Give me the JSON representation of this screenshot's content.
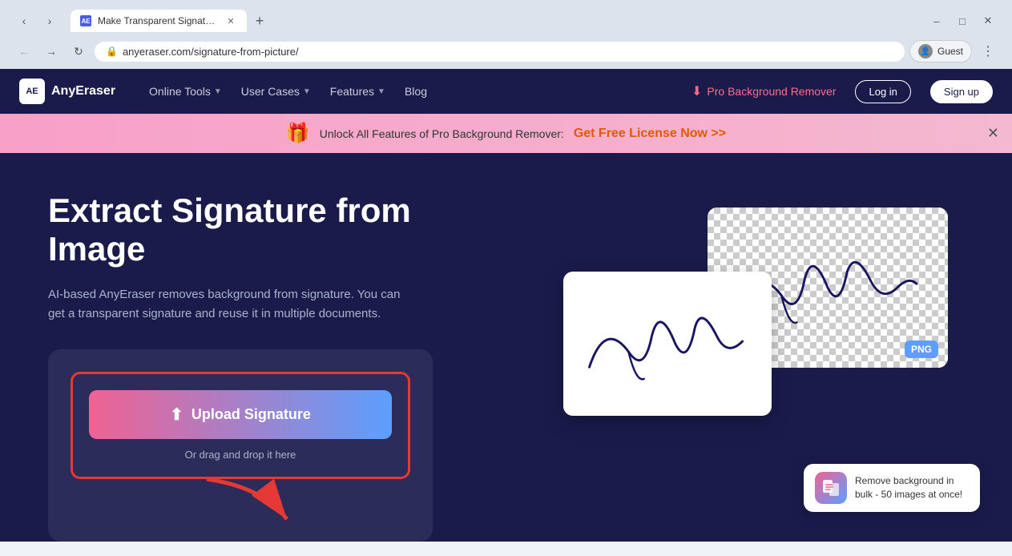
{
  "browser": {
    "tab_title": "Make Transparent Signature",
    "tab_favicon": "AE",
    "url": "anyeraser.com/signature-from-picture/",
    "profile_label": "Guest"
  },
  "nav": {
    "logo_text": "AnyEraser",
    "logo_abbr": "AE",
    "links": [
      {
        "label": "Online Tools",
        "has_dropdown": true
      },
      {
        "label": "User Cases",
        "has_dropdown": true
      },
      {
        "label": "Features",
        "has_dropdown": true
      },
      {
        "label": "Blog",
        "has_dropdown": false
      }
    ],
    "pro_label": "Pro Background Remover",
    "login_label": "Log in",
    "signup_label": "Sign up"
  },
  "banner": {
    "text": "Unlock All Features of Pro Background Remover:",
    "cta": "Get Free License Now >>"
  },
  "hero": {
    "title": "Extract Signature from Image",
    "subtitle": "AI-based AnyEraser removes background from signature. You can get a transparent signature and reuse it in multiple documents.",
    "upload_label": "Upload Signature",
    "upload_hint": "Or drag and drop it here",
    "upload_icon": "⬆"
  },
  "bulk_widget": {
    "text": "Remove background in bulk - 50 images at once!"
  }
}
